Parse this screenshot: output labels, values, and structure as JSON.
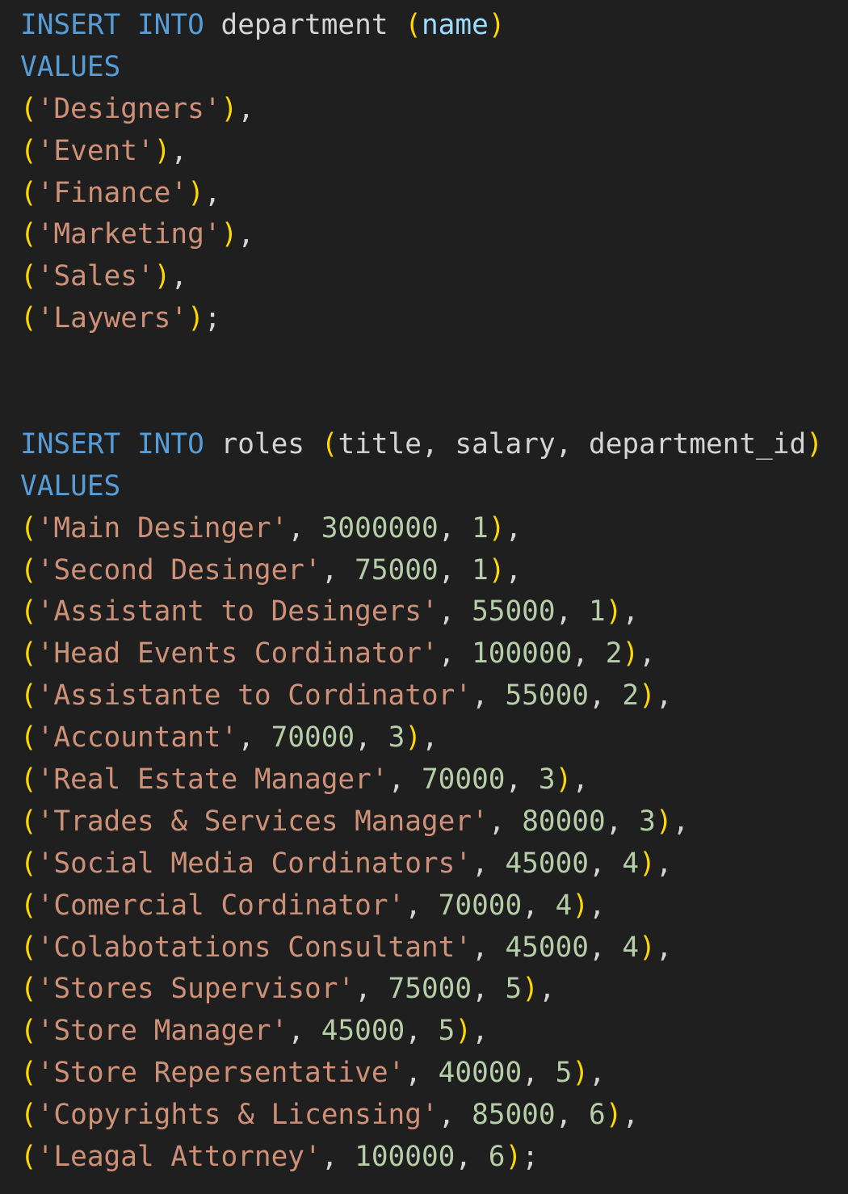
{
  "editor": {
    "colors": {
      "background": "#1f1f1f",
      "keyword": "#569cd6",
      "identifier": "#d4d4d4",
      "column": "#9cdcfe",
      "bracket": "#ffd700",
      "string": "#ce9178",
      "number": "#b5cea8",
      "punctuation": "#d4d4d4"
    },
    "lines": [
      [
        [
          "kw",
          "INSERT"
        ],
        [
          "p",
          " "
        ],
        [
          "kw",
          "INTO"
        ],
        [
          "id",
          " department "
        ],
        [
          "paren",
          "("
        ],
        [
          "col",
          "name"
        ],
        [
          "paren",
          ")"
        ]
      ],
      [
        [
          "kw",
          "VALUES"
        ]
      ],
      [
        [
          "paren",
          "("
        ],
        [
          "str",
          "'Designers'"
        ],
        [
          "paren",
          ")"
        ],
        [
          "p",
          ","
        ]
      ],
      [
        [
          "paren",
          "("
        ],
        [
          "str",
          "'Event'"
        ],
        [
          "paren",
          ")"
        ],
        [
          "p",
          ","
        ]
      ],
      [
        [
          "paren",
          "("
        ],
        [
          "str",
          "'Finance'"
        ],
        [
          "paren",
          ")"
        ],
        [
          "p",
          ","
        ]
      ],
      [
        [
          "paren",
          "("
        ],
        [
          "str",
          "'Marketing'"
        ],
        [
          "paren",
          ")"
        ],
        [
          "p",
          ","
        ]
      ],
      [
        [
          "paren",
          "("
        ],
        [
          "str",
          "'Sales'"
        ],
        [
          "paren",
          ")"
        ],
        [
          "p",
          ","
        ]
      ],
      [
        [
          "paren",
          "("
        ],
        [
          "str",
          "'Laywers'"
        ],
        [
          "paren",
          ")"
        ],
        [
          "p",
          ";"
        ]
      ],
      [],
      [],
      [
        [
          "kw",
          "INSERT"
        ],
        [
          "p",
          " "
        ],
        [
          "kw",
          "INTO"
        ],
        [
          "id",
          " roles "
        ],
        [
          "paren",
          "("
        ],
        [
          "id",
          "title, salary, department_id"
        ],
        [
          "paren",
          ")"
        ]
      ],
      [
        [
          "kw",
          "VALUES"
        ]
      ],
      [
        [
          "paren",
          "("
        ],
        [
          "str",
          "'Main Desinger'"
        ],
        [
          "p",
          ", "
        ],
        [
          "num",
          "3000000"
        ],
        [
          "p",
          ", "
        ],
        [
          "num",
          "1"
        ],
        [
          "paren",
          ")"
        ],
        [
          "p",
          ","
        ]
      ],
      [
        [
          "paren",
          "("
        ],
        [
          "str",
          "'Second Desinger'"
        ],
        [
          "p",
          ", "
        ],
        [
          "num",
          "75000"
        ],
        [
          "p",
          ", "
        ],
        [
          "num",
          "1"
        ],
        [
          "paren",
          ")"
        ],
        [
          "p",
          ","
        ]
      ],
      [
        [
          "paren",
          "("
        ],
        [
          "str",
          "'Assistant to Desingers'"
        ],
        [
          "p",
          ", "
        ],
        [
          "num",
          "55000"
        ],
        [
          "p",
          ", "
        ],
        [
          "num",
          "1"
        ],
        [
          "paren",
          ")"
        ],
        [
          "p",
          ","
        ]
      ],
      [
        [
          "paren",
          "("
        ],
        [
          "str",
          "'Head Events Cordinator'"
        ],
        [
          "p",
          ", "
        ],
        [
          "num",
          "100000"
        ],
        [
          "p",
          ", "
        ],
        [
          "num",
          "2"
        ],
        [
          "paren",
          ")"
        ],
        [
          "p",
          ","
        ]
      ],
      [
        [
          "paren",
          "("
        ],
        [
          "str",
          "'Assistante to Cordinator'"
        ],
        [
          "p",
          ", "
        ],
        [
          "num",
          "55000"
        ],
        [
          "p",
          ", "
        ],
        [
          "num",
          "2"
        ],
        [
          "paren",
          ")"
        ],
        [
          "p",
          ","
        ]
      ],
      [
        [
          "paren",
          "("
        ],
        [
          "str",
          "'Accountant'"
        ],
        [
          "p",
          ", "
        ],
        [
          "num",
          "70000"
        ],
        [
          "p",
          ", "
        ],
        [
          "num",
          "3"
        ],
        [
          "paren",
          ")"
        ],
        [
          "p",
          ","
        ]
      ],
      [
        [
          "paren",
          "("
        ],
        [
          "str",
          "'Real Estate Manager'"
        ],
        [
          "p",
          ", "
        ],
        [
          "num",
          "70000"
        ],
        [
          "p",
          ", "
        ],
        [
          "num",
          "3"
        ],
        [
          "paren",
          ")"
        ],
        [
          "p",
          ","
        ]
      ],
      [
        [
          "paren",
          "("
        ],
        [
          "str",
          "'Trades & Services Manager'"
        ],
        [
          "p",
          ", "
        ],
        [
          "num",
          "80000"
        ],
        [
          "p",
          ", "
        ],
        [
          "num",
          "3"
        ],
        [
          "paren",
          ")"
        ],
        [
          "p",
          ","
        ]
      ],
      [
        [
          "paren",
          "("
        ],
        [
          "str",
          "'Social Media Cordinators'"
        ],
        [
          "p",
          ", "
        ],
        [
          "num",
          "45000"
        ],
        [
          "p",
          ", "
        ],
        [
          "num",
          "4"
        ],
        [
          "paren",
          ")"
        ],
        [
          "p",
          ","
        ]
      ],
      [
        [
          "paren",
          "("
        ],
        [
          "str",
          "'Comercial Cordinator'"
        ],
        [
          "p",
          ", "
        ],
        [
          "num",
          "70000"
        ],
        [
          "p",
          ", "
        ],
        [
          "num",
          "4"
        ],
        [
          "paren",
          ")"
        ],
        [
          "p",
          ","
        ]
      ],
      [
        [
          "paren",
          "("
        ],
        [
          "str",
          "'Colabotations Consultant'"
        ],
        [
          "p",
          ", "
        ],
        [
          "num",
          "45000"
        ],
        [
          "p",
          ", "
        ],
        [
          "num",
          "4"
        ],
        [
          "paren",
          ")"
        ],
        [
          "p",
          ","
        ]
      ],
      [
        [
          "paren",
          "("
        ],
        [
          "str",
          "'Stores Supervisor'"
        ],
        [
          "p",
          ", "
        ],
        [
          "num",
          "75000"
        ],
        [
          "p",
          ", "
        ],
        [
          "num",
          "5"
        ],
        [
          "paren",
          ")"
        ],
        [
          "p",
          ","
        ]
      ],
      [
        [
          "paren",
          "("
        ],
        [
          "str",
          "'Store Manager'"
        ],
        [
          "p",
          ", "
        ],
        [
          "num",
          "45000"
        ],
        [
          "p",
          ", "
        ],
        [
          "num",
          "5"
        ],
        [
          "paren",
          ")"
        ],
        [
          "p",
          ","
        ]
      ],
      [
        [
          "paren",
          "("
        ],
        [
          "str",
          "'Store Repersentative'"
        ],
        [
          "p",
          ", "
        ],
        [
          "num",
          "40000"
        ],
        [
          "p",
          ", "
        ],
        [
          "num",
          "5"
        ],
        [
          "paren",
          ")"
        ],
        [
          "p",
          ","
        ]
      ],
      [
        [
          "paren",
          "("
        ],
        [
          "str",
          "'Copyrights & Licensing'"
        ],
        [
          "p",
          ", "
        ],
        [
          "num",
          "85000"
        ],
        [
          "p",
          ", "
        ],
        [
          "num",
          "6"
        ],
        [
          "paren",
          ")"
        ],
        [
          "p",
          ","
        ]
      ],
      [
        [
          "paren",
          "("
        ],
        [
          "str",
          "'Leagal Attorney'"
        ],
        [
          "p",
          ", "
        ],
        [
          "num",
          "100000"
        ],
        [
          "p",
          ", "
        ],
        [
          "num",
          "6"
        ],
        [
          "paren",
          ")"
        ],
        [
          "p",
          ";"
        ]
      ]
    ]
  }
}
